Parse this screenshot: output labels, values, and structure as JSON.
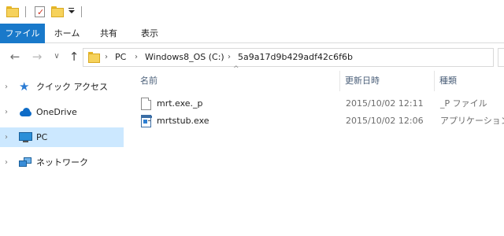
{
  "quick_access": {
    "dropdown_icon": "customize-quick-access-icon"
  },
  "ribbon": {
    "tabs": [
      {
        "label": "ファイル",
        "active": true
      },
      {
        "label": "ホーム"
      },
      {
        "label": "共有"
      },
      {
        "label": "表示"
      }
    ]
  },
  "nav": {
    "back_icon": "back-arrow-icon",
    "forward_icon": "forward-arrow-icon",
    "recent_icon": "recent-locations-icon",
    "up_icon": "up-arrow-icon",
    "back_glyph": "←",
    "forward_glyph": "→",
    "recent_glyph": "∨",
    "up_glyph": "↑"
  },
  "address": {
    "separator": "›",
    "crumbs": [
      "PC",
      "Windows8_OS (C:)",
      "5a9a17d9b429adf42c6f6b"
    ]
  },
  "sidebar": {
    "chevron": "›",
    "items": [
      {
        "label": "クイック アクセス",
        "icon": "star-icon"
      },
      {
        "label": "OneDrive",
        "icon": "cloud-icon"
      },
      {
        "label": "PC",
        "icon": "computer-icon",
        "selected": true
      },
      {
        "label": "ネットワーク",
        "icon": "network-icon"
      }
    ]
  },
  "columns": {
    "name": "名前",
    "modified": "更新日時",
    "type": "種類",
    "sort_glyph": "^"
  },
  "files": [
    {
      "name": "mrt.exe._p",
      "modified": "2015/10/02 12:11",
      "type": "_P ファイル",
      "icon": "generic-file-icon"
    },
    {
      "name": "mrtstub.exe",
      "modified": "2015/10/02 12:06",
      "type": "アプリケーション",
      "icon": "application-file-icon"
    }
  ],
  "colors": {
    "accent": "#1979ca",
    "selection": "#cce8ff",
    "folder": "#f6d25c"
  }
}
